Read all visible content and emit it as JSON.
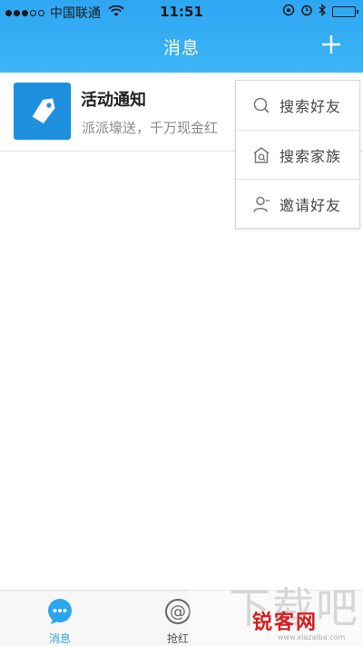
{
  "statusbar": {
    "carrier": "中国联通",
    "time": "11:51"
  },
  "header": {
    "title": "消息",
    "add_icon": "plus-icon"
  },
  "messages": [
    {
      "title": "活动通知",
      "preview": "派派壕送，千万现金红",
      "icon": "tag-icon",
      "icon_color": "#1e90dd"
    }
  ],
  "menu": {
    "items": [
      {
        "label": "搜索好友",
        "icon": "search-icon"
      },
      {
        "label": "搜索家族",
        "icon": "house-search-icon"
      },
      {
        "label": "邀请好友",
        "icon": "person-add-icon"
      }
    ]
  },
  "tabbar": {
    "tabs": [
      {
        "label": "消息",
        "icon": "chat-bubble-icon",
        "active": true
      },
      {
        "label": "抢红",
        "icon": "at-icon",
        "active": false
      }
    ]
  },
  "watermark": {
    "text": "下载吧",
    "brand": "锐客网",
    "url": "www.xiazaiba.com"
  },
  "colors": {
    "header_blue": "#2fa6f3",
    "accent": "#2aa6ec",
    "tag_blue": "#1e90dd"
  }
}
